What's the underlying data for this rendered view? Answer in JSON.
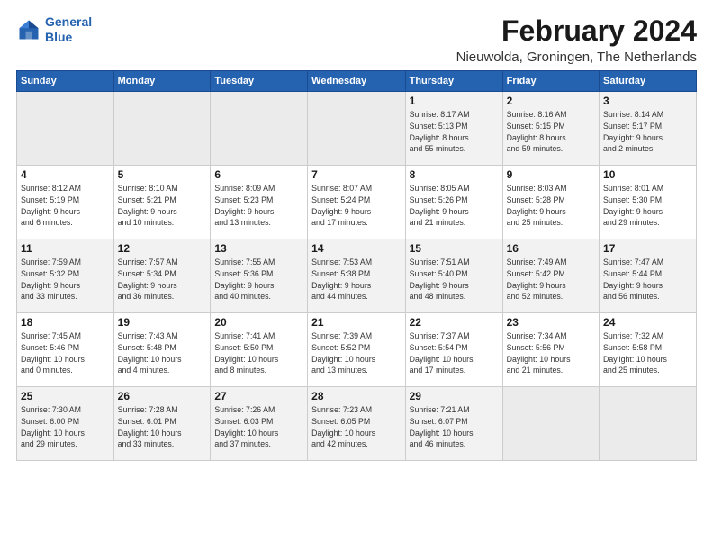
{
  "logo": {
    "line1": "General",
    "line2": "Blue"
  },
  "title": "February 2024",
  "subtitle": "Nieuwolda, Groningen, The Netherlands",
  "weekdays": [
    "Sunday",
    "Monday",
    "Tuesday",
    "Wednesday",
    "Thursday",
    "Friday",
    "Saturday"
  ],
  "weeks": [
    [
      {
        "day": "",
        "info": ""
      },
      {
        "day": "",
        "info": ""
      },
      {
        "day": "",
        "info": ""
      },
      {
        "day": "",
        "info": ""
      },
      {
        "day": "1",
        "info": "Sunrise: 8:17 AM\nSunset: 5:13 PM\nDaylight: 8 hours\nand 55 minutes."
      },
      {
        "day": "2",
        "info": "Sunrise: 8:16 AM\nSunset: 5:15 PM\nDaylight: 8 hours\nand 59 minutes."
      },
      {
        "day": "3",
        "info": "Sunrise: 8:14 AM\nSunset: 5:17 PM\nDaylight: 9 hours\nand 2 minutes."
      }
    ],
    [
      {
        "day": "4",
        "info": "Sunrise: 8:12 AM\nSunset: 5:19 PM\nDaylight: 9 hours\nand 6 minutes."
      },
      {
        "day": "5",
        "info": "Sunrise: 8:10 AM\nSunset: 5:21 PM\nDaylight: 9 hours\nand 10 minutes."
      },
      {
        "day": "6",
        "info": "Sunrise: 8:09 AM\nSunset: 5:23 PM\nDaylight: 9 hours\nand 13 minutes."
      },
      {
        "day": "7",
        "info": "Sunrise: 8:07 AM\nSunset: 5:24 PM\nDaylight: 9 hours\nand 17 minutes."
      },
      {
        "day": "8",
        "info": "Sunrise: 8:05 AM\nSunset: 5:26 PM\nDaylight: 9 hours\nand 21 minutes."
      },
      {
        "day": "9",
        "info": "Sunrise: 8:03 AM\nSunset: 5:28 PM\nDaylight: 9 hours\nand 25 minutes."
      },
      {
        "day": "10",
        "info": "Sunrise: 8:01 AM\nSunset: 5:30 PM\nDaylight: 9 hours\nand 29 minutes."
      }
    ],
    [
      {
        "day": "11",
        "info": "Sunrise: 7:59 AM\nSunset: 5:32 PM\nDaylight: 9 hours\nand 33 minutes."
      },
      {
        "day": "12",
        "info": "Sunrise: 7:57 AM\nSunset: 5:34 PM\nDaylight: 9 hours\nand 36 minutes."
      },
      {
        "day": "13",
        "info": "Sunrise: 7:55 AM\nSunset: 5:36 PM\nDaylight: 9 hours\nand 40 minutes."
      },
      {
        "day": "14",
        "info": "Sunrise: 7:53 AM\nSunset: 5:38 PM\nDaylight: 9 hours\nand 44 minutes."
      },
      {
        "day": "15",
        "info": "Sunrise: 7:51 AM\nSunset: 5:40 PM\nDaylight: 9 hours\nand 48 minutes."
      },
      {
        "day": "16",
        "info": "Sunrise: 7:49 AM\nSunset: 5:42 PM\nDaylight: 9 hours\nand 52 minutes."
      },
      {
        "day": "17",
        "info": "Sunrise: 7:47 AM\nSunset: 5:44 PM\nDaylight: 9 hours\nand 56 minutes."
      }
    ],
    [
      {
        "day": "18",
        "info": "Sunrise: 7:45 AM\nSunset: 5:46 PM\nDaylight: 10 hours\nand 0 minutes."
      },
      {
        "day": "19",
        "info": "Sunrise: 7:43 AM\nSunset: 5:48 PM\nDaylight: 10 hours\nand 4 minutes."
      },
      {
        "day": "20",
        "info": "Sunrise: 7:41 AM\nSunset: 5:50 PM\nDaylight: 10 hours\nand 8 minutes."
      },
      {
        "day": "21",
        "info": "Sunrise: 7:39 AM\nSunset: 5:52 PM\nDaylight: 10 hours\nand 13 minutes."
      },
      {
        "day": "22",
        "info": "Sunrise: 7:37 AM\nSunset: 5:54 PM\nDaylight: 10 hours\nand 17 minutes."
      },
      {
        "day": "23",
        "info": "Sunrise: 7:34 AM\nSunset: 5:56 PM\nDaylight: 10 hours\nand 21 minutes."
      },
      {
        "day": "24",
        "info": "Sunrise: 7:32 AM\nSunset: 5:58 PM\nDaylight: 10 hours\nand 25 minutes."
      }
    ],
    [
      {
        "day": "25",
        "info": "Sunrise: 7:30 AM\nSunset: 6:00 PM\nDaylight: 10 hours\nand 29 minutes."
      },
      {
        "day": "26",
        "info": "Sunrise: 7:28 AM\nSunset: 6:01 PM\nDaylight: 10 hours\nand 33 minutes."
      },
      {
        "day": "27",
        "info": "Sunrise: 7:26 AM\nSunset: 6:03 PM\nDaylight: 10 hours\nand 37 minutes."
      },
      {
        "day": "28",
        "info": "Sunrise: 7:23 AM\nSunset: 6:05 PM\nDaylight: 10 hours\nand 42 minutes."
      },
      {
        "day": "29",
        "info": "Sunrise: 7:21 AM\nSunset: 6:07 PM\nDaylight: 10 hours\nand 46 minutes."
      },
      {
        "day": "",
        "info": ""
      },
      {
        "day": "",
        "info": ""
      }
    ]
  ]
}
